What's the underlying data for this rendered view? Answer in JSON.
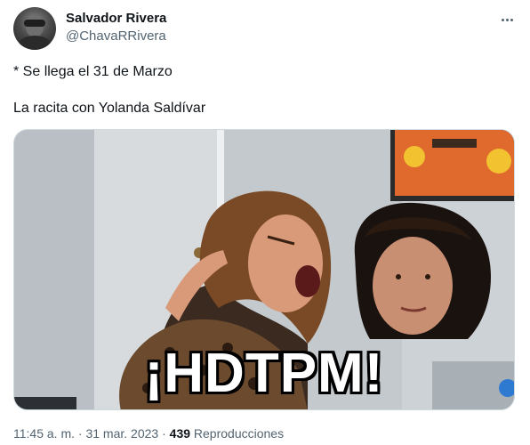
{
  "author": {
    "name": "Salvador Rivera",
    "handle": "@ChavaRRivera"
  },
  "tweet": {
    "line1": "* Se llega el 31 de Marzo",
    "line2": "La racita con Yolanda Saldívar"
  },
  "media": {
    "caption": "¡HDTPM!"
  },
  "meta": {
    "time": "11:45 a. m.",
    "separator1": " · ",
    "date": "31 mar. 2023",
    "separator2": " · ",
    "views_count": "439",
    "views_label": " Reproducciones"
  },
  "icons": {
    "more": "more-horizontal-icon"
  },
  "colors": {
    "text_primary": "#0f1419",
    "text_secondary": "#536471",
    "border": "#cfd9de"
  }
}
